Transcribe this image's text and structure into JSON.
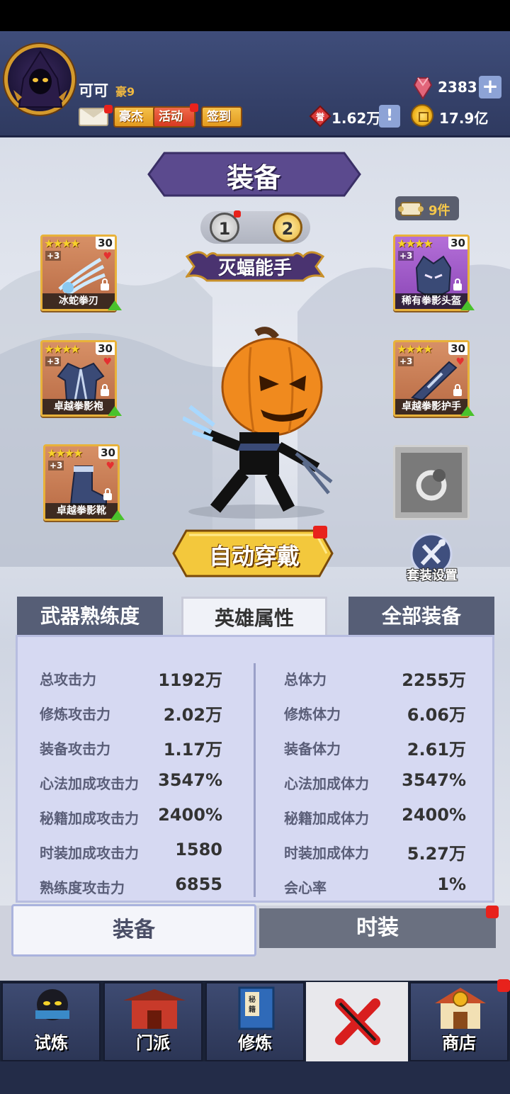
{
  "player": {
    "name": "可可",
    "vip": "豪9"
  },
  "header_buttons": {
    "hero": "豪杰",
    "activity": "活动",
    "signin": "签到"
  },
  "currency": {
    "gems": "2383",
    "honor": "1.62万",
    "gold": "17.9亿",
    "plus": "+",
    "info": "!"
  },
  "page": {
    "title": "装备",
    "set_count": "9件",
    "pages": [
      "1",
      "2"
    ],
    "active_set_name": "灭蝠能手"
  },
  "equipment": [
    {
      "name": "冰蛇拳刃",
      "stars": "★★★★",
      "level": "30",
      "plus": "+3",
      "rarity": "orange"
    },
    {
      "name": "卓越拳影袍",
      "stars": "★★★★",
      "level": "30",
      "plus": "+3",
      "rarity": "orange"
    },
    {
      "name": "卓越拳影靴",
      "stars": "★★★★",
      "level": "30",
      "plus": "+3",
      "rarity": "orange"
    },
    {
      "name": "稀有拳影头盔",
      "stars": "★★★★",
      "level": "30",
      "plus": "+3",
      "rarity": "purple"
    },
    {
      "name": "卓越拳影护手",
      "stars": "★★★★",
      "level": "30",
      "plus": "+3",
      "rarity": "orange"
    }
  ],
  "actions": {
    "auto_equip": "自动穿戴",
    "suit_settings": "套装设置"
  },
  "stat_tabs": [
    "武器熟练度",
    "英雄属性",
    "全部装备"
  ],
  "stats_left": [
    {
      "label": "总攻击力",
      "value": "1192万"
    },
    {
      "label": "修炼攻击力",
      "value": "2.02万"
    },
    {
      "label": "装备攻击力",
      "value": "1.17万"
    },
    {
      "label": "心法加成攻击力",
      "value": "3547%"
    },
    {
      "label": "秘籍加成攻击力",
      "value": "2400%"
    },
    {
      "label": "时装加成攻击力",
      "value": "1580"
    },
    {
      "label": "熟练度攻击力",
      "value": "6855"
    }
  ],
  "stats_right": [
    {
      "label": "总体力",
      "value": "2255万"
    },
    {
      "label": "修炼体力",
      "value": "6.06万"
    },
    {
      "label": "装备体力",
      "value": "2.61万"
    },
    {
      "label": "心法加成体力",
      "value": "3547%"
    },
    {
      "label": "秘籍加成体力",
      "value": "2400%"
    },
    {
      "label": "时装加成体力",
      "value": "5.27万"
    },
    {
      "label": "会心率",
      "value": "1%"
    }
  ],
  "toggle": {
    "equip": "装备",
    "costume": "时装"
  },
  "nav": [
    "试炼",
    "门派",
    "修炼",
    "",
    "商店"
  ],
  "nav_icon_text": {
    "manual": "秘籍"
  },
  "colors": {
    "accent_purple": "#5b4a8e",
    "gold": "#f0b840",
    "red_dot": "#e8221c"
  }
}
